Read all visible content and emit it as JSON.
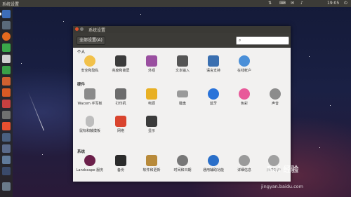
{
  "topbar": {
    "app_title": "系统设置",
    "clock": "19:05",
    "indicators": [
      "network-icon",
      "keyboard-icon",
      "mail-icon",
      "volume-icon",
      "power-icon"
    ]
  },
  "window": {
    "title": "系统设置",
    "all_settings_label": "全部设置(A)",
    "search_placeholder": ""
  },
  "sections": {
    "personal": {
      "title": "个人",
      "items": [
        {
          "label": "安全和隐私",
          "icon": "security-privacy-icon",
          "color": "#f2c14a"
        },
        {
          "label": "亮度和锁屏",
          "icon": "brightness-lock-icon",
          "color": "#3b3b3b"
        },
        {
          "label": "外观",
          "icon": "appearance-icon",
          "color": "#9a4fa0"
        },
        {
          "label": "文本输入",
          "icon": "text-entry-icon",
          "color": "#555555"
        },
        {
          "label": "语言支持",
          "icon": "language-support-icon",
          "color": "#3a6fb0"
        },
        {
          "label": "在线帐户",
          "icon": "online-accounts-icon",
          "color": "#4a8fd8"
        }
      ]
    },
    "hardware": {
      "title": "硬件",
      "items": [
        {
          "label": "Wacom 手写板",
          "icon": "wacom-tablet-icon",
          "color": "#8a8a8a"
        },
        {
          "label": "打印机",
          "icon": "printer-icon",
          "color": "#6c6c6c"
        },
        {
          "label": "电源",
          "icon": "power-icon",
          "color": "#e8b024"
        },
        {
          "label": "键盘",
          "icon": "keyboard-icon",
          "color": "#9a9a9a"
        },
        {
          "label": "蓝牙",
          "icon": "bluetooth-icon",
          "color": "#2a73d9"
        },
        {
          "label": "色彩",
          "icon": "color-icon",
          "color": "#e85a9a"
        },
        {
          "label": "声音",
          "icon": "sound-icon",
          "color": "#8c8c8c"
        },
        {
          "label": "鼠标和触摸板",
          "icon": "mouse-touchpad-icon",
          "color": "#bdbdbd"
        },
        {
          "label": "网络",
          "icon": "network-icon",
          "color": "#d9442e"
        },
        {
          "label": "显示",
          "icon": "display-icon",
          "color": "#3b3b3b"
        }
      ]
    },
    "system": {
      "title": "系统",
      "items": [
        {
          "label": "Landscape 服务",
          "icon": "landscape-service-icon",
          "color": "#6b1f4a"
        },
        {
          "label": "备份",
          "icon": "backup-icon",
          "color": "#2b2b2b"
        },
        {
          "label": "软件和更新",
          "icon": "software-updates-icon",
          "color": "#b88a3a"
        },
        {
          "label": "时间和日期",
          "icon": "time-date-icon",
          "color": "#777777"
        },
        {
          "label": "通用辅助功能",
          "icon": "universal-access-icon",
          "color": "#2a6fc9"
        },
        {
          "label": "详细信息",
          "icon": "details-icon",
          "color": "#9a9a9a"
        },
        {
          "label": "用户帐户",
          "icon": "user-accounts-icon",
          "color": "#a0a0a0"
        }
      ]
    }
  },
  "watermark": {
    "brand": "Bai 经验",
    "url": "jingyan.baidu.com"
  }
}
